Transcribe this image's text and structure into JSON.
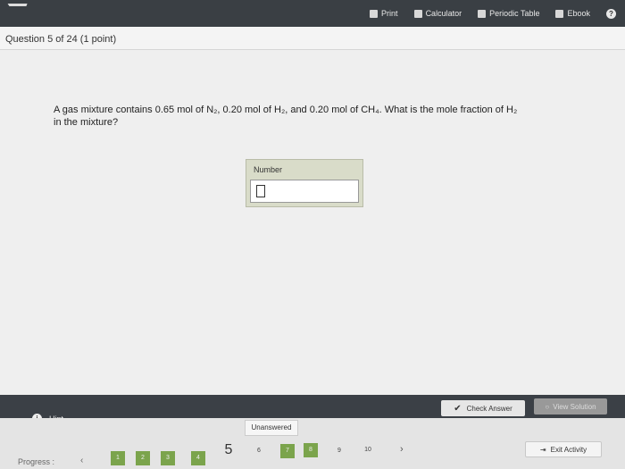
{
  "toolbar": {
    "print": "Print",
    "calculator": "Calculator",
    "periodic_table": "Periodic Table",
    "ebook": "Ebook"
  },
  "question": {
    "title": "Question 5 of 24 (1 point)",
    "text_line1": "A gas mixture contains 0.65 mol of N₂, 0.20 mol of H₂, and 0.20 mol of CH₄. What is the mole fraction of H₂",
    "text_line2": "in the mixture?"
  },
  "answer": {
    "label": "Number",
    "value": ""
  },
  "actions": {
    "check_answer": "Check Answer",
    "view_solution": "View Solution",
    "hint": "Hint"
  },
  "status": "Unanswered",
  "progress": {
    "label": "Progress :",
    "pages": [
      "1",
      "2",
      "3",
      "4",
      "5",
      "6",
      "7",
      "8",
      "9",
      "10"
    ],
    "completed": [
      1,
      2,
      3,
      4,
      7,
      8
    ],
    "current": 5
  },
  "exit": "Exit Activity",
  "colors": {
    "completed": "#7ba44c",
    "topbar": "#3a3f44"
  }
}
